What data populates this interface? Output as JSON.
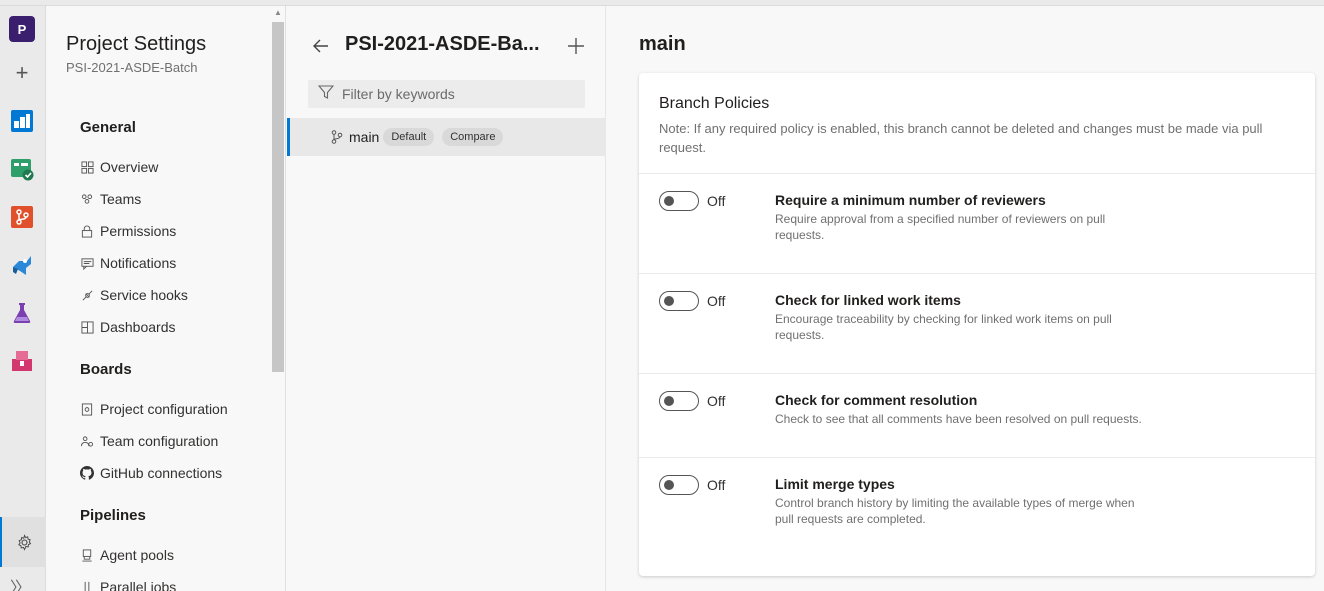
{
  "rail": {
    "project_initial": "P",
    "icons": [
      "plus-icon",
      "boards-icon",
      "test-plans-check-icon",
      "repos-icon",
      "pipelines-icon",
      "test-plans-icon",
      "artifacts-icon"
    ],
    "colors": {
      "boards": "#0078d4",
      "repos": "#e0502a",
      "pipelines": "#2b88d8",
      "test": "#7b3fb0",
      "artifacts": "#d2376d"
    }
  },
  "nav": {
    "title": "Project Settings",
    "subtitle": "PSI-2021-ASDE-Batch",
    "groups": {
      "general": "General",
      "boards": "Boards",
      "pipelines": "Pipelines"
    },
    "general_items": [
      "Overview",
      "Teams",
      "Permissions",
      "Notifications",
      "Service hooks",
      "Dashboards"
    ],
    "boards_items": [
      "Project configuration",
      "Team configuration",
      "GitHub connections"
    ],
    "pipelines_items": [
      "Agent pools",
      "Parallel jobs"
    ]
  },
  "branches": {
    "repo_title": "PSI-2021-ASDE-Ba...",
    "filter_placeholder": "Filter by keywords",
    "selected_branch": {
      "name": "main",
      "badge": "Default",
      "compare": "Compare"
    }
  },
  "main": {
    "title": "main",
    "card": {
      "title": "Branch Policies",
      "note": "Note: If any required policy is enabled, this branch cannot be deleted and changes must be made via pull request.",
      "policies": [
        {
          "state": "Off",
          "title": "Require a minimum number of reviewers",
          "desc": "Require approval from a specified number of reviewers on pull requests."
        },
        {
          "state": "Off",
          "title": "Check for linked work items",
          "desc": "Encourage traceability by checking for linked work items on pull requests."
        },
        {
          "state": "Off",
          "title": "Check for comment resolution",
          "desc": "Check to see that all comments have been resolved on pull requests."
        },
        {
          "state": "Off",
          "title": "Limit merge types",
          "desc": "Control branch history by limiting the available types of merge when pull requests are completed."
        }
      ]
    }
  }
}
